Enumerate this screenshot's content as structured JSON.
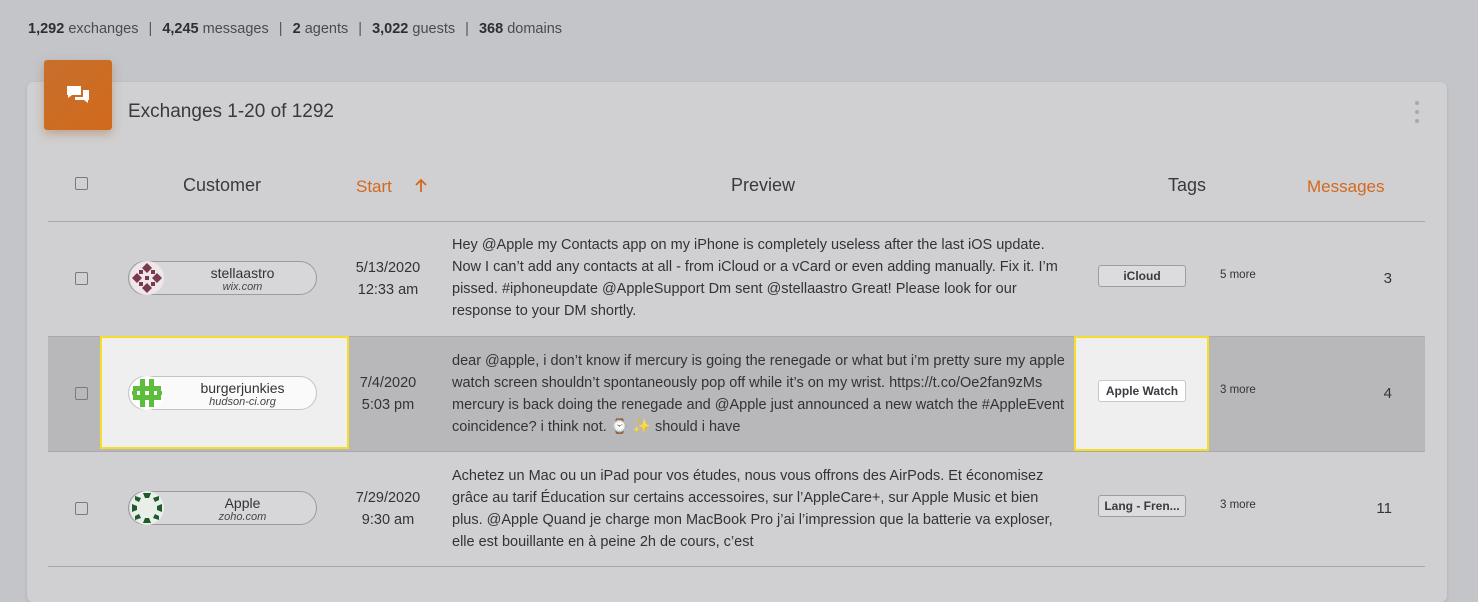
{
  "stats": {
    "exchanges_count": "1,292",
    "exchanges_label": "exchanges",
    "messages_count": "4,245",
    "messages_label": "messages",
    "agents_count": "2",
    "agents_label": "agents",
    "guests_count": "3,022",
    "guests_label": "guests",
    "domains_count": "368",
    "domains_label": "domains",
    "separator": "|"
  },
  "card": {
    "icon": "chat-bubbles-icon",
    "title": "Exchanges 1-20 of 1292",
    "menu_icon": "more-vertical-icon"
  },
  "columns": {
    "customer": "Customer",
    "start": "Start",
    "start_sort_icon": "arrow-up-icon",
    "preview": "Preview",
    "tags": "Tags",
    "messages": "Messages"
  },
  "colors": {
    "accent": "#d2691e",
    "highlight": "#f4de2a"
  },
  "rows": [
    {
      "customer_name": "stellaastro",
      "customer_domain": "wix.com",
      "date": "5/13/2020",
      "time": "12:33 am",
      "preview": "Hey @Apple my Contacts app on my iPhone is completely useless after the last iOS update. Now I can’t add any contacts at all - from iCloud or a vCard or even adding manually. Fix it. I’m pissed. #iphoneupdate @AppleSupport Dm sent @stellaastro Great! Please look for our response to your DM shortly.",
      "tag": "iCloud",
      "more": "5 more",
      "messages": "3"
    },
    {
      "customer_name": "burgerjunkies",
      "customer_domain": "hudson-ci.org",
      "date": "7/4/2020",
      "time": "5:03 pm",
      "preview": "dear @apple, i don’t know if mercury is going the renegade or what but i’m pretty sure my apple watch screen shouldn’t spontaneously pop off while it’s on my wrist. https://t.co/Oe2fan9zMs mercury is back doing the renegade and @Apple just announced a new watch the #AppleEvent  coincidence? i think not. ⌚ ✨  should i have",
      "tag": "Apple Watch",
      "more": "3 more",
      "messages": "4"
    },
    {
      "customer_name": "Apple",
      "customer_domain": "zoho.com",
      "date": "7/29/2020",
      "time": "9:30 am",
      "preview": "Achetez un Mac ou un iPad pour vos études, nous vous offrons des AirPods. Et économisez grâce au tarif Éducation sur certains accessoires, sur l’AppleCare+, sur Apple Music et bien plus. @Apple Quand je charge mon MacBook Pro j’ai l’impression que la batterie va exploser, elle est bouillante en à peine 2h de cours, c’est",
      "tag": "Lang - Fren...",
      "more": "3 more",
      "messages": "11"
    }
  ]
}
